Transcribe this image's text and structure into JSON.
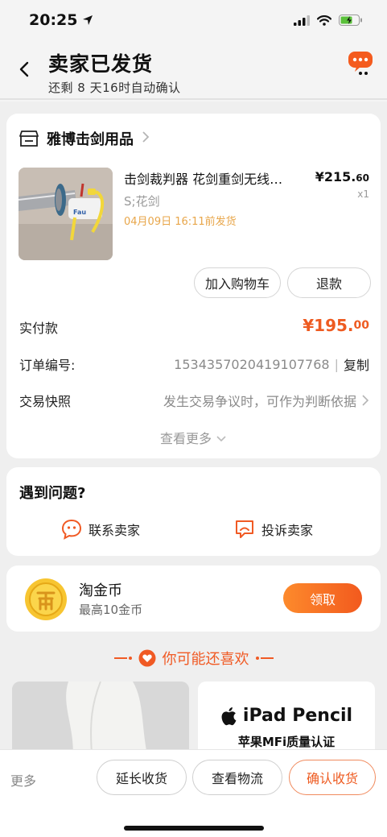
{
  "status_bar": {
    "time": "20:25"
  },
  "header": {
    "title": "卖家已发货",
    "subtitle": "还剩 8 天16时自动确认"
  },
  "shop": {
    "name": "雅博击剑用品"
  },
  "product": {
    "title": "击剑裁判器 花剑重剑无线…",
    "price_main": "¥215.",
    "price_decimal": "60",
    "sku": "S;花剑",
    "quantity": "x1",
    "ship_time": "04月09日 16:11前发货",
    "image_label": "Fau"
  },
  "actions": {
    "add_to_cart": "加入购物车",
    "refund": "退款"
  },
  "order_info": {
    "paid_label": "实付款",
    "paid_main": "¥195.",
    "paid_decimal": "00",
    "order_no_label": "订单编号:",
    "order_no": "1534357020419107768",
    "separator": "|",
    "copy": "复制",
    "snapshot_label": "交易快照",
    "snapshot_value": "发生交易争议时，可作为判断依据",
    "see_more": "查看更多"
  },
  "problem": {
    "title": "遇到问题?",
    "contact_seller": "联系卖家",
    "complain_seller": "投诉卖家"
  },
  "coins": {
    "title": "淘金币",
    "subtitle": "最高10金币",
    "claim": "领取"
  },
  "recommend": {
    "header": "你可能还喜欢",
    "ipad_title": "iPad Pencil",
    "ipad_sub": "苹果MFi质量认证"
  },
  "bottom_bar": {
    "more": "更多",
    "extend": "延长收货",
    "logistics": "查看物流",
    "confirm": "确认收货"
  },
  "colors": {
    "accent": "#ee5b21",
    "ship_time": "#e8a64a",
    "coin": "#f7c531"
  },
  "icons": [
    "location-arrow-icon",
    "signal-icon",
    "wifi-icon",
    "battery-icon",
    "back-icon",
    "message-icon",
    "store-icon",
    "chevron-right-icon",
    "chevron-down-icon",
    "smile-chat-icon",
    "complaint-chat-icon",
    "coin-icon",
    "heart-icon",
    "apple-icon"
  ]
}
